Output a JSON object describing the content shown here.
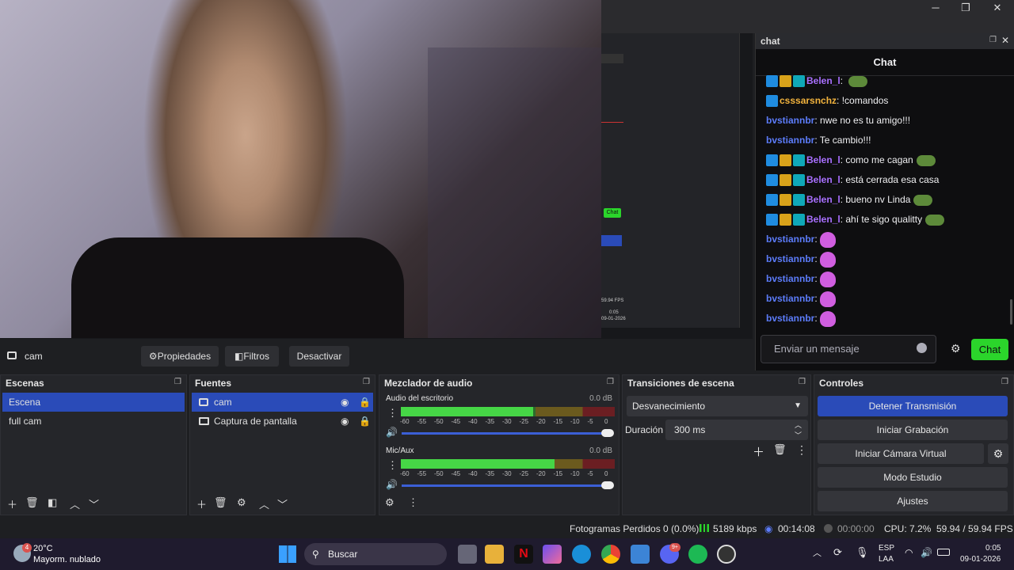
{
  "window": {
    "minimize": "─",
    "maximize": "❐",
    "close": "✕"
  },
  "embedded_obs": {
    "chat_tag": "Chat",
    "fps": "59.94 FPS",
    "time1": "0:05",
    "time2": "09-01-2026"
  },
  "chat": {
    "dock_title": "chat",
    "header": "Chat",
    "messages": [
      {
        "badges": [
          "blue",
          "gold",
          "cyan"
        ],
        "user": "Belen_l",
        "color": "#a970ff",
        "text": ": ",
        "emote": true
      },
      {
        "badges": [
          "blue"
        ],
        "user": "csssarsnchz",
        "color": "#f2b33d",
        "text": ": !comandos"
      },
      {
        "badges": [],
        "user": "bvstiannbr",
        "color": "#5c7cfa",
        "text": ": nwe no es tu amigo!!!"
      },
      {
        "badges": [],
        "user": "bvstiannbr",
        "color": "#5c7cfa",
        "text": ": Te cambio!!!"
      },
      {
        "badges": [
          "blue",
          "gold",
          "cyan"
        ],
        "user": "Belen_l",
        "color": "#a970ff",
        "text": ": como me cagan",
        "emote": true
      },
      {
        "badges": [
          "blue",
          "gold",
          "cyan"
        ],
        "user": "Belen_l",
        "color": "#a970ff",
        "text": ": está cerrada esa casa"
      },
      {
        "badges": [
          "blue",
          "gold",
          "cyan"
        ],
        "user": "Belen_l",
        "color": "#a970ff",
        "text": ": bueno nv Linda",
        "emote": true
      },
      {
        "badges": [
          "blue",
          "gold",
          "cyan"
        ],
        "user": "Belen_l",
        "color": "#a970ff",
        "text": ": ahí te sigo qualitty",
        "emote": true
      },
      {
        "badges": [],
        "user": "bvstiannbr",
        "color": "#5c7cfa",
        "text": ": ",
        "heart": true
      },
      {
        "badges": [],
        "user": "bvstiannbr",
        "color": "#5c7cfa",
        "text": ": ",
        "heart": true
      },
      {
        "badges": [],
        "user": "bvstiannbr",
        "color": "#5c7cfa",
        "text": ": ",
        "heart": true
      },
      {
        "badges": [],
        "user": "bvstiannbr",
        "color": "#5c7cfa",
        "text": ": ",
        "heart": true
      },
      {
        "badges": [],
        "user": "bvstiannbr",
        "color": "#5c7cfa",
        "text": ": ",
        "heart": true
      }
    ],
    "input_placeholder": "Enviar un mensaje",
    "send_label": "Chat"
  },
  "source_toolbar": {
    "source_name": "cam",
    "properties": "Propiedades",
    "filters": "Filtros",
    "deactivate": "Desactivar"
  },
  "scenes": {
    "title": "Escenas",
    "items": [
      "Escena",
      "full cam"
    ],
    "selected": 0
  },
  "sources": {
    "title": "Fuentes",
    "items": [
      "cam",
      "Captura de pantalla"
    ]
  },
  "mixer": {
    "title": "Mezclador de audio",
    "channels": [
      {
        "name": "Audio del escritorio",
        "db": "0.0 dB",
        "level": 0.62
      },
      {
        "name": "Mic/Aux",
        "db": "0.0 dB",
        "level": 0.72
      }
    ],
    "scale": [
      "-60",
      "-55",
      "-50",
      "-45",
      "-40",
      "-35",
      "-30",
      "-25",
      "-20",
      "-15",
      "-10",
      "-5",
      "0"
    ]
  },
  "transitions": {
    "title": "Transiciones de escena",
    "selected": "Desvanecimiento",
    "duration_label": "Duración",
    "duration_value": "300 ms"
  },
  "controls": {
    "title": "Controles",
    "stop_stream": "Detener Transmisión",
    "start_record": "Iniciar Grabación",
    "start_vcam": "Iniciar Cámara Virtual",
    "studio_mode": "Modo Estudio",
    "settings": "Ajustes"
  },
  "status": {
    "dropped": "Fotogramas Perdidos 0 (0.0%)",
    "bitrate": "5189 kbps",
    "stream_time": "00:14:08",
    "record_time": "00:00:00",
    "cpu": "CPU: 7.2%",
    "fps": "59.94 / 59.94 FPS"
  },
  "taskbar": {
    "weather_temp": "20°C",
    "weather_desc": "Mayorm. nublado",
    "weather_badge": "4",
    "search": "Buscar",
    "lang1": "ESP",
    "lang2": "LAA",
    "time": "0:05",
    "date": "09-01-2026",
    "discord_badge": "9+"
  },
  "colors": {
    "accent": "#2a4bb8",
    "chat_send": "#2bd52b",
    "stop_button": "#2a4bb8"
  }
}
